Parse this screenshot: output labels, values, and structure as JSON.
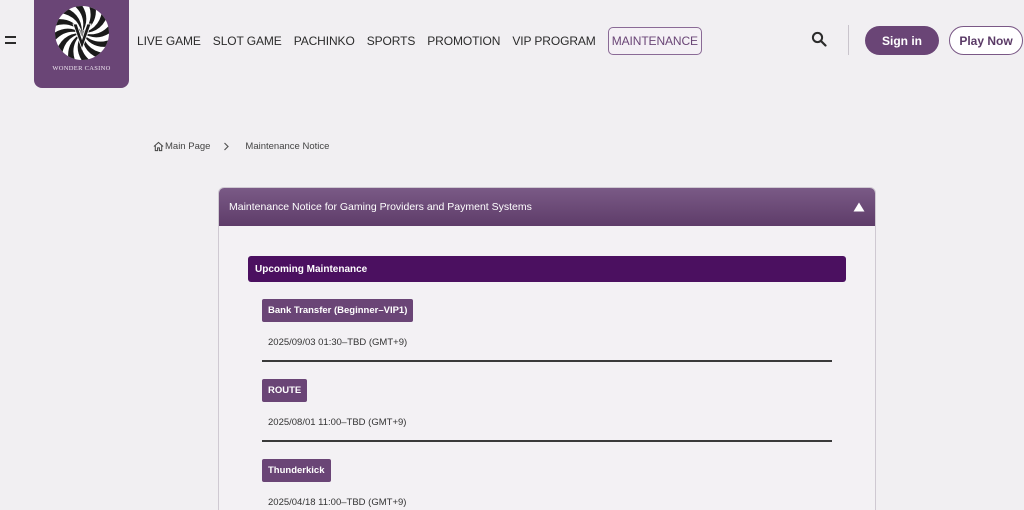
{
  "header": {
    "logo_text": "WONDER CASINO",
    "nav": [
      "LIVE GAME",
      "SLOT GAME",
      "PACHINKO",
      "SPORTS",
      "PROMOTION",
      "VIP PROGRAM",
      "MAINTENANCE"
    ],
    "active_nav": "MAINTENANCE",
    "sign_in_label": "Sign in",
    "play_now_label": "Play Now",
    "icons": [
      "menu-icon",
      "search-icon"
    ]
  },
  "breadcrumb": {
    "home": "Main Page",
    "current": "Maintenance Notice"
  },
  "card": {
    "title": "Maintenance Notice for Gaming Providers and Payment Systems",
    "section_title": "Upcoming Maintenance",
    "entries": [
      {
        "name": "Bank Transfer (Beginner–VIP1)",
        "time": "2025/09/03 01:30–TBD (GMT+9)"
      },
      {
        "name": "ROUTE",
        "time": "2025/08/01 11:00–TBD (GMT+9)"
      },
      {
        "name": "Thunderkick",
        "time": "2025/04/18 11:00–TBD (GMT+9)"
      }
    ]
  },
  "colors": {
    "brand": "#6a4576",
    "section": "#4b1060",
    "background": "#f1eff2"
  }
}
